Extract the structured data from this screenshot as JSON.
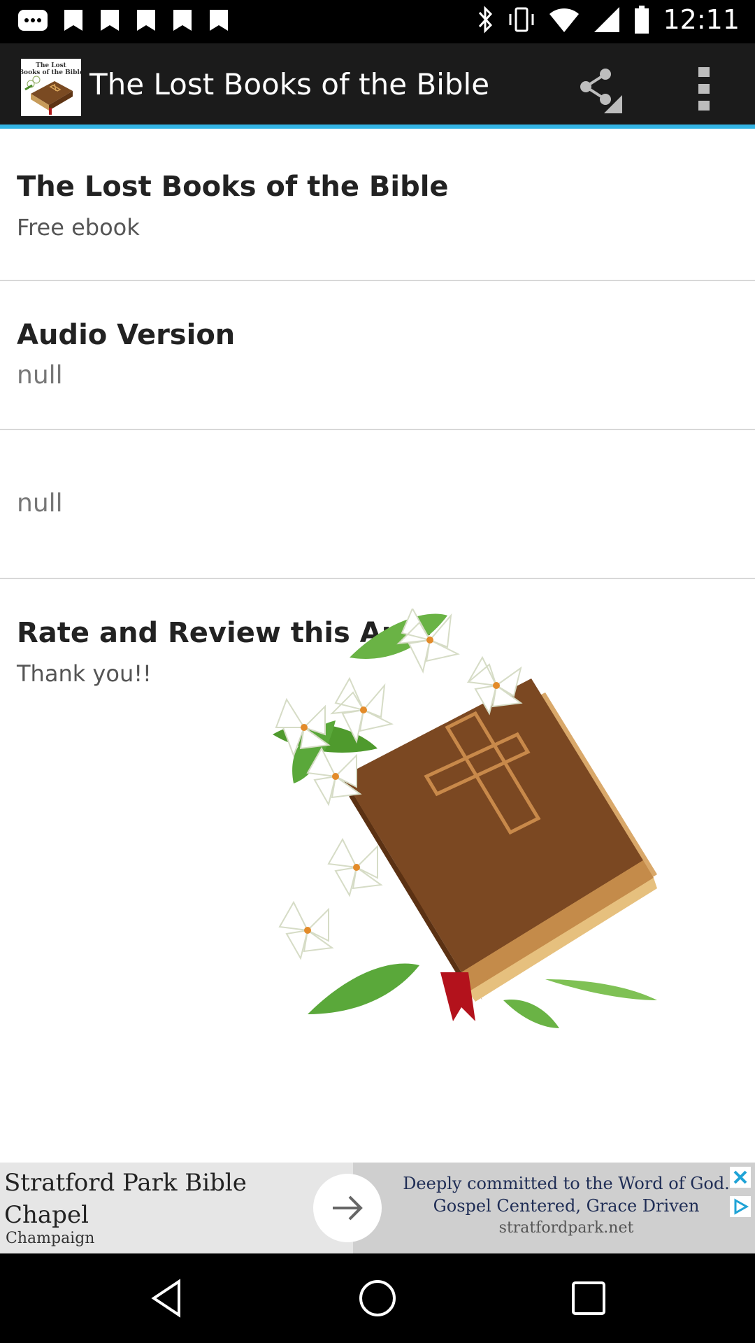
{
  "status_bar": {
    "time": "12:11",
    "icons": [
      "message-icon",
      "notification-icon",
      "notification-icon",
      "notification-icon",
      "notification-icon",
      "notification-icon",
      "bluetooth-icon",
      "vibrate-icon",
      "wifi-icon",
      "signal-icon",
      "battery-icon"
    ]
  },
  "app_bar": {
    "title": "The Lost Books of the Bible",
    "icon_label": "The Lost Books of the Bible",
    "share_icon": "share-icon",
    "overflow_icon": "more-vert-icon",
    "accent_color": "#33b5e5"
  },
  "list": {
    "items": [
      {
        "title": "The Lost Books of the Bible",
        "subtitle": "Free ebook"
      },
      {
        "title": "Audio Version",
        "subtitle": "null"
      },
      {
        "title": "",
        "subtitle": "null"
      },
      {
        "title": "Rate and Review this App!",
        "subtitle": "Thank you!!"
      }
    ]
  },
  "ad": {
    "left_title": "Stratford Park Bible Chapel",
    "left_subtitle": "Champaign",
    "right_line1": "Deeply committed to the Word of God.",
    "right_line2": "Gospel Centered, Grace Driven",
    "right_url": "stratfordpark.net",
    "close_icon": "close-icon",
    "adchoices_icon": "adchoices-icon",
    "arrow_icon": "arrow-right-icon"
  },
  "nav_bar": {
    "back_icon": "back-icon",
    "home_icon": "home-icon",
    "recent_icon": "recent-apps-icon"
  }
}
